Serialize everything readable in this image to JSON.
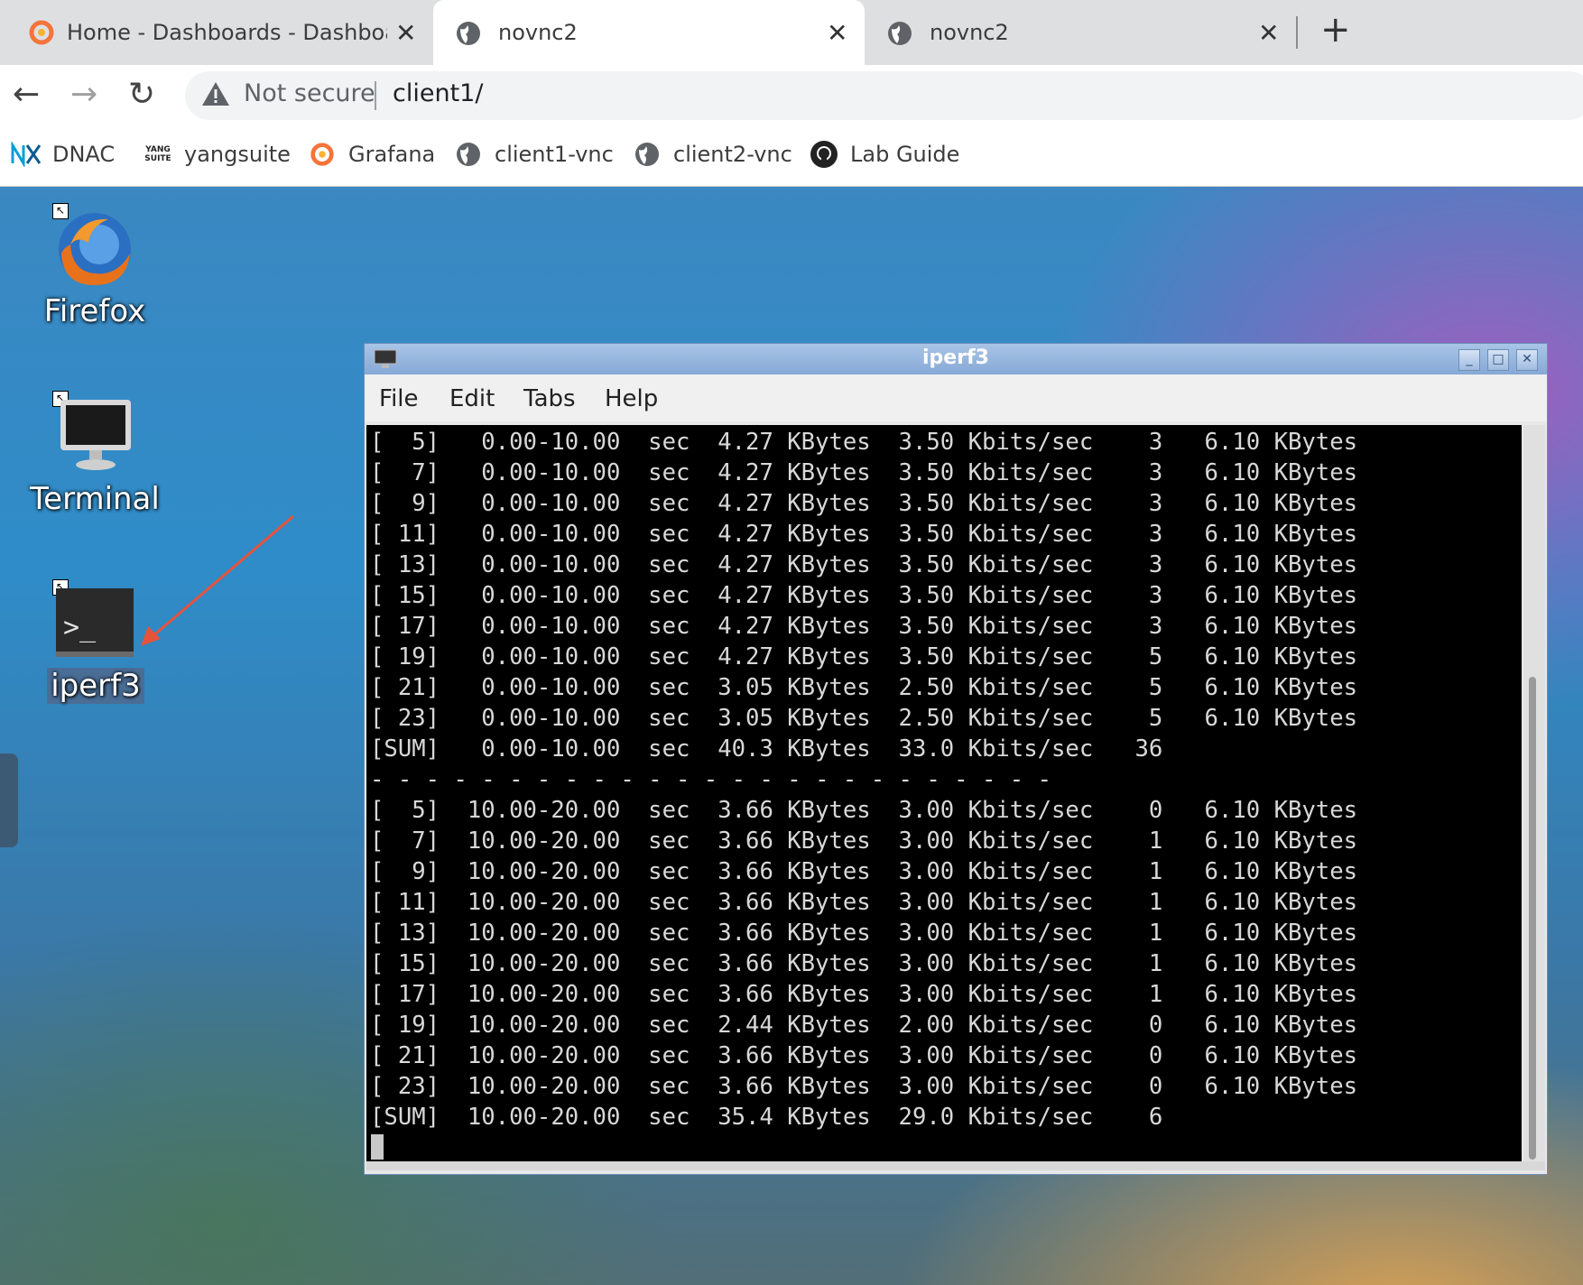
{
  "browser": {
    "tabs": [
      {
        "title": "Home - Dashboards - Dashboard",
        "icon": "grafana-icon",
        "active": false
      },
      {
        "title": "novnc2",
        "icon": "globe-icon",
        "active": true
      },
      {
        "title": "novnc2",
        "icon": "globe-icon",
        "active": false
      }
    ],
    "omnibox": {
      "security": "Not secure",
      "url": "client1/"
    },
    "bookmarks": [
      {
        "label": "DNAC",
        "icon": "dnac-icon"
      },
      {
        "label": "yangsuite",
        "icon": "yangsuite-icon"
      },
      {
        "label": "Grafana",
        "icon": "grafana-icon"
      },
      {
        "label": "client1-vnc",
        "icon": "globe-icon"
      },
      {
        "label": "client2-vnc",
        "icon": "globe-icon"
      },
      {
        "label": "Lab Guide",
        "icon": "github-icon"
      }
    ],
    "icon_glyphs": {
      "close": "✕",
      "new_tab": "+",
      "back": "←",
      "forward": "→",
      "reload": "↻",
      "warning": "⚠"
    },
    "yangsuite_icon_text": "YANG SUITE"
  },
  "desktop": {
    "icons": [
      {
        "label": "Firefox",
        "icon": "firefox-icon"
      },
      {
        "label": "Terminal",
        "icon": "terminal-monitor-icon"
      },
      {
        "label": "iperf3",
        "icon": "terminal-prompt-icon",
        "selected": true
      }
    ],
    "annotation_arrow_color": "#e5533d",
    "shortcut_glyph": "↖",
    "prompt_glyph": ">_"
  },
  "window": {
    "title": "iperf3",
    "menu": [
      "File",
      "Edit",
      "Tabs",
      "Help"
    ],
    "controls": {
      "minimize": "_",
      "maximize": "□",
      "close": "✕"
    }
  },
  "terminal": {
    "lines": [
      "[  5]   0.00-10.00  sec  4.27 KBytes  3.50 Kbits/sec    3   6.10 KBytes",
      "[  7]   0.00-10.00  sec  4.27 KBytes  3.50 Kbits/sec    3   6.10 KBytes",
      "[  9]   0.00-10.00  sec  4.27 KBytes  3.50 Kbits/sec    3   6.10 KBytes",
      "[ 11]   0.00-10.00  sec  4.27 KBytes  3.50 Kbits/sec    3   6.10 KBytes",
      "[ 13]   0.00-10.00  sec  4.27 KBytes  3.50 Kbits/sec    3   6.10 KBytes",
      "[ 15]   0.00-10.00  sec  4.27 KBytes  3.50 Kbits/sec    3   6.10 KBytes",
      "[ 17]   0.00-10.00  sec  4.27 KBytes  3.50 Kbits/sec    3   6.10 KBytes",
      "[ 19]   0.00-10.00  sec  4.27 KBytes  3.50 Kbits/sec    5   6.10 KBytes",
      "[ 21]   0.00-10.00  sec  3.05 KBytes  2.50 Kbits/sec    5   6.10 KBytes",
      "[ 23]   0.00-10.00  sec  3.05 KBytes  2.50 Kbits/sec    5   6.10 KBytes",
      "[SUM]   0.00-10.00  sec  40.3 KBytes  33.0 Kbits/sec   36",
      "- - - - - - - - - - - - - - - - - - - - - - - - -",
      "[  5]  10.00-20.00  sec  3.66 KBytes  3.00 Kbits/sec    0   6.10 KBytes",
      "[  7]  10.00-20.00  sec  3.66 KBytes  3.00 Kbits/sec    1   6.10 KBytes",
      "[  9]  10.00-20.00  sec  3.66 KBytes  3.00 Kbits/sec    1   6.10 KBytes",
      "[ 11]  10.00-20.00  sec  3.66 KBytes  3.00 Kbits/sec    1   6.10 KBytes",
      "[ 13]  10.00-20.00  sec  3.66 KBytes  3.00 Kbits/sec    1   6.10 KBytes",
      "[ 15]  10.00-20.00  sec  3.66 KBytes  3.00 Kbits/sec    1   6.10 KBytes",
      "[ 17]  10.00-20.00  sec  3.66 KBytes  3.00 Kbits/sec    1   6.10 KBytes",
      "[ 19]  10.00-20.00  sec  2.44 KBytes  2.00 Kbits/sec    0   6.10 KBytes",
      "[ 21]  10.00-20.00  sec  3.66 KBytes  3.00 Kbits/sec    0   6.10 KBytes",
      "[ 23]  10.00-20.00  sec  3.66 KBytes  3.00 Kbits/sec    0   6.10 KBytes",
      "[SUM]  10.00-20.00  sec  35.4 KBytes  29.0 Kbits/sec    6"
    ],
    "foreground": "#d8d8d8",
    "background": "#000000"
  }
}
